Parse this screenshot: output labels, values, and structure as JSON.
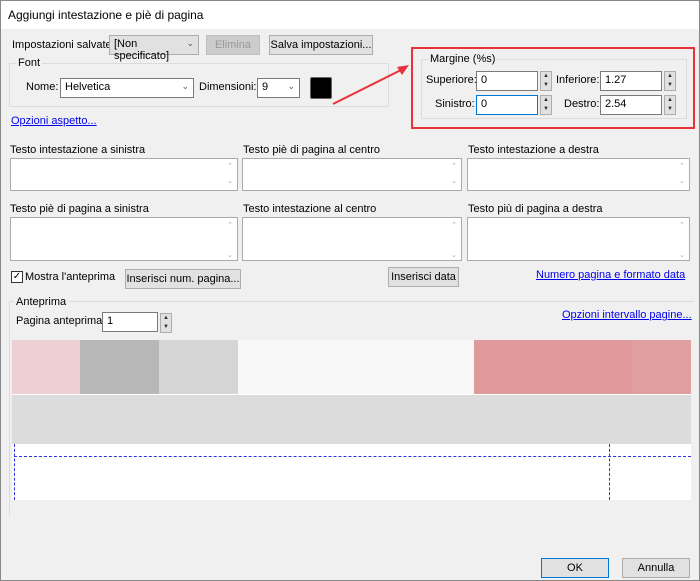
{
  "title": "Aggiungi intestazione e piè di pagina",
  "saved": {
    "label": "Impostazioni salvate:",
    "value": "[Non specificato]",
    "delete": "Elimina",
    "save": "Salva impostazioni..."
  },
  "font": {
    "legend": "Font",
    "name_label": "Nome:",
    "name_value": "Helvetica",
    "size_label": "Dimensioni:",
    "size_value": "9",
    "color": "#000000"
  },
  "appearance_link": "Opzioni aspetto...",
  "margins": {
    "legend": "Margine (%s)",
    "top_label": "Superiore:",
    "top": "0",
    "bottom_label": "Inferiore:",
    "bottom": "1.27",
    "left_label": "Sinistro:",
    "left": "0",
    "right_label": "Destro:",
    "right": "2.54"
  },
  "fields": [
    "Testo intestazione a sinistra",
    "Testo piè di pagina al centro",
    "Testo intestazione a destra",
    "Testo piè di pagina a sinistra",
    "Testo intestazione al centro",
    "Testo più di pagina a destra"
  ],
  "show_preview": {
    "label": "Mostra l'anteprima",
    "checked": true
  },
  "insert_page": "Inserisci num. pagina...",
  "insert_date": "Inserisci data",
  "page_date_link": "Numero pagina e formato data",
  "preview": {
    "legend": "Anteprima",
    "page_label": "Pagina anteprima:",
    "page_value": "1",
    "range_link": "Opzioni intervallo pagine..."
  },
  "ok": "OK",
  "cancel": "Annulla"
}
